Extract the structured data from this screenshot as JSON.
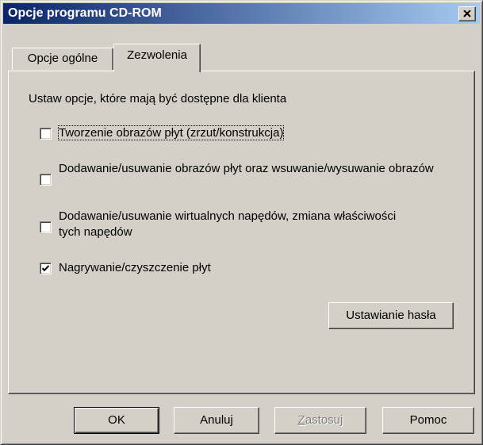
{
  "window": {
    "title": "Opcje programu CD-ROM",
    "close_icon": "close-icon"
  },
  "tabs": [
    {
      "label": "Opcje ogólne",
      "active": false
    },
    {
      "label": "Zezwolenia",
      "active": true
    }
  ],
  "permissions": {
    "intro": "Ustaw opcje, które mają być dostępne dla klienta",
    "options": [
      {
        "label": "Tworzenie obrazów płyt (zrzut/konstrukcja)",
        "checked": false,
        "focused": true
      },
      {
        "label": "Dodawanie/usuwanie obrazów płyt oraz wsuwanie/wysuwanie obrazów",
        "checked": false
      },
      {
        "label": "Dodawanie/usuwanie wirtualnych napędów, zmiana właściwości tych napędów",
        "checked": false
      },
      {
        "label": "Nagrywanie/czyszczenie płyt",
        "checked": true
      }
    ],
    "set_password_button": "Ustawianie hasła"
  },
  "footer": {
    "ok": "OK",
    "cancel": "Anuluj",
    "apply_underlined": "Z",
    "apply_rest": "astosuj",
    "apply_enabled": false,
    "help": "Pomoc"
  }
}
